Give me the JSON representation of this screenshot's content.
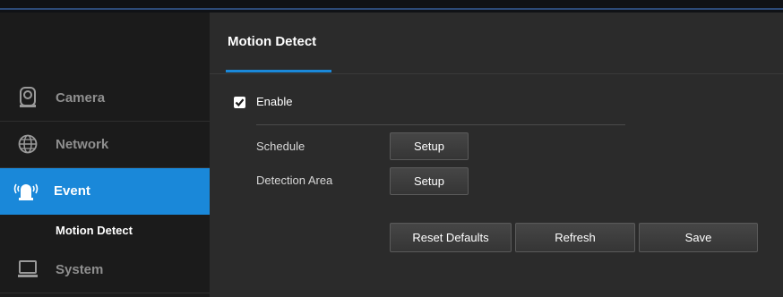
{
  "sidebar": {
    "items": [
      {
        "label": "Camera",
        "icon": "camera-icon"
      },
      {
        "label": "Network",
        "icon": "network-icon"
      },
      {
        "label": "Event",
        "icon": "event-alarm-icon",
        "active": true
      },
      {
        "label": "System",
        "icon": "system-monitor-icon"
      }
    ],
    "sub_item": "Motion Detect"
  },
  "main": {
    "tab": "Motion Detect",
    "enable_label": "Enable",
    "enable_checked": true,
    "schedule_label": "Schedule",
    "schedule_button": "Setup",
    "detection_label": "Detection Area",
    "detection_button": "Setup",
    "reset_button": "Reset Defaults",
    "refresh_button": "Refresh",
    "save_button": "Save"
  },
  "colors": {
    "accent": "#1a88d9",
    "sidebar_bg": "#1b1b1b",
    "main_bg": "#2b2b2b"
  }
}
